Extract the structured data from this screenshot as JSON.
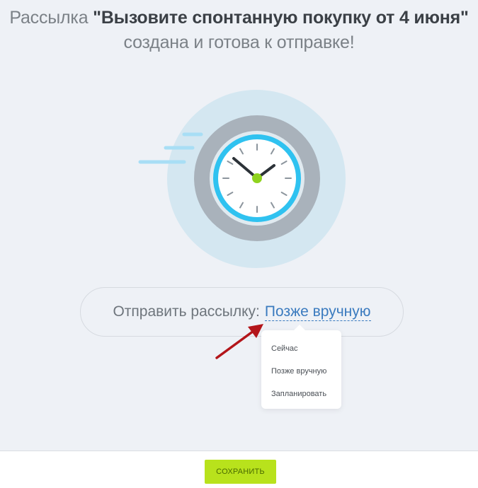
{
  "header": {
    "prefix": "Рассылка ",
    "campaign_name": "\"Вызовите спонтанную покупку от 4 июня\"",
    "status_line": "создана и готова к отправке!"
  },
  "illustration": {
    "icon": "clock-icon"
  },
  "send": {
    "label": "Отправить рассылку:",
    "selected": "Позже вручную"
  },
  "dropdown": {
    "options": [
      "Сейчас",
      "Позже вручную",
      "Запланировать"
    ]
  },
  "footer": {
    "save_label": "СОХРАНИТЬ"
  },
  "colors": {
    "accent_link": "#3b7bbf",
    "save_button": "#b8e21c",
    "clock_ring": "#33c3ef",
    "annotation_arrow": "#b3151a"
  }
}
